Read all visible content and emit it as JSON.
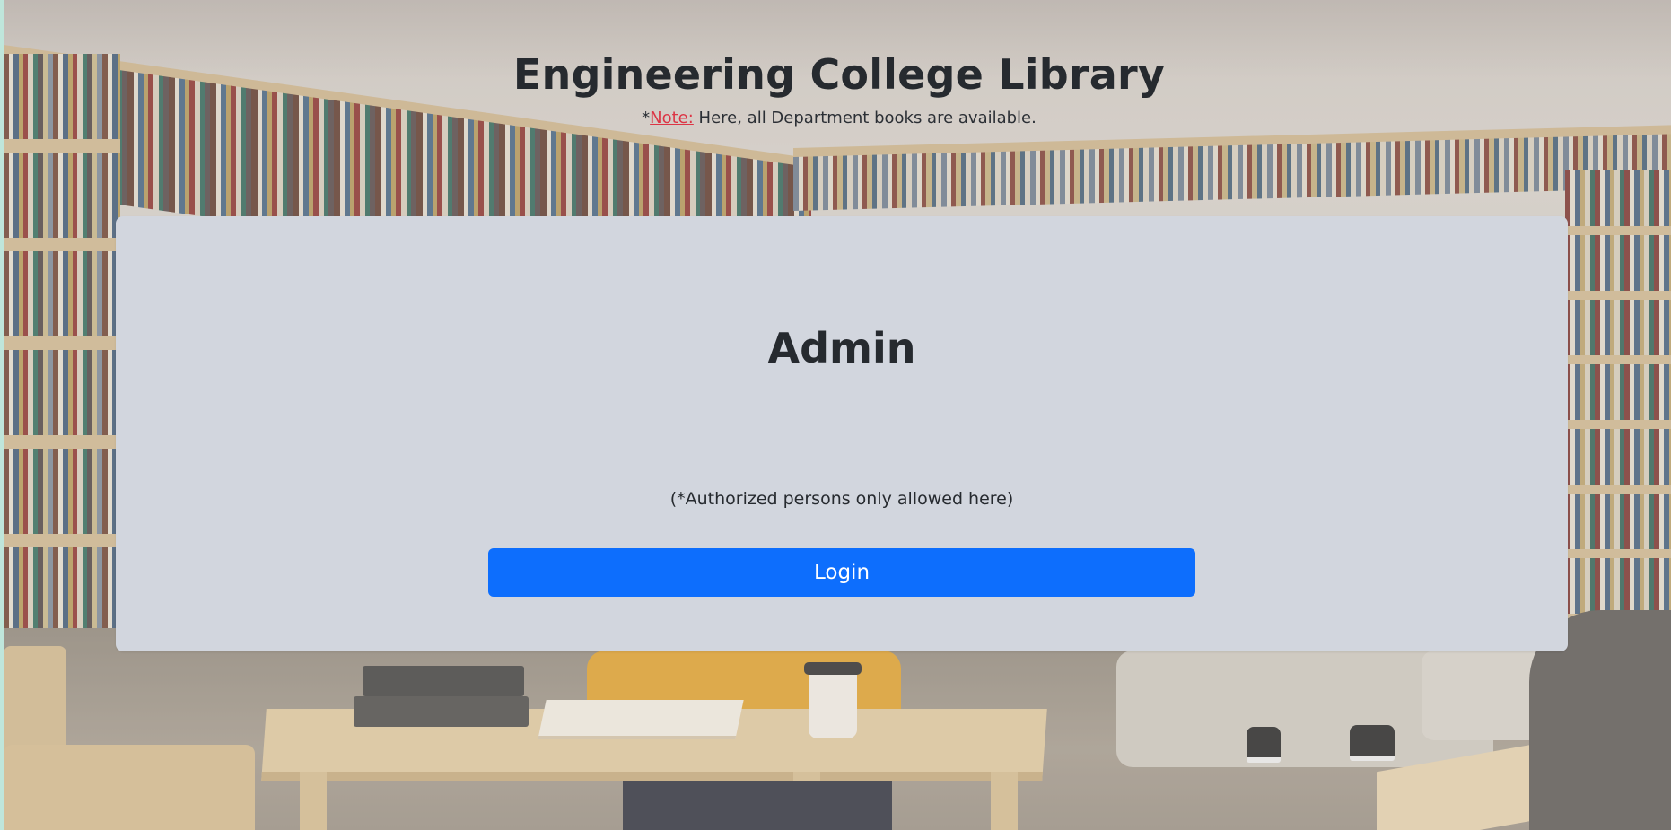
{
  "header": {
    "title": "Engineering College Library",
    "note_prefix": "*",
    "note_label": "Note:",
    "note_text": " Here, all Department books are available."
  },
  "card": {
    "title": "Admin",
    "subtext": "(*Authorized persons only allowed here)",
    "login_label": "Login"
  },
  "colors": {
    "primary_button": "#0d6efd",
    "note_label": "#dc3545",
    "card_background": "#d2d6de",
    "text": "#262a2f"
  }
}
